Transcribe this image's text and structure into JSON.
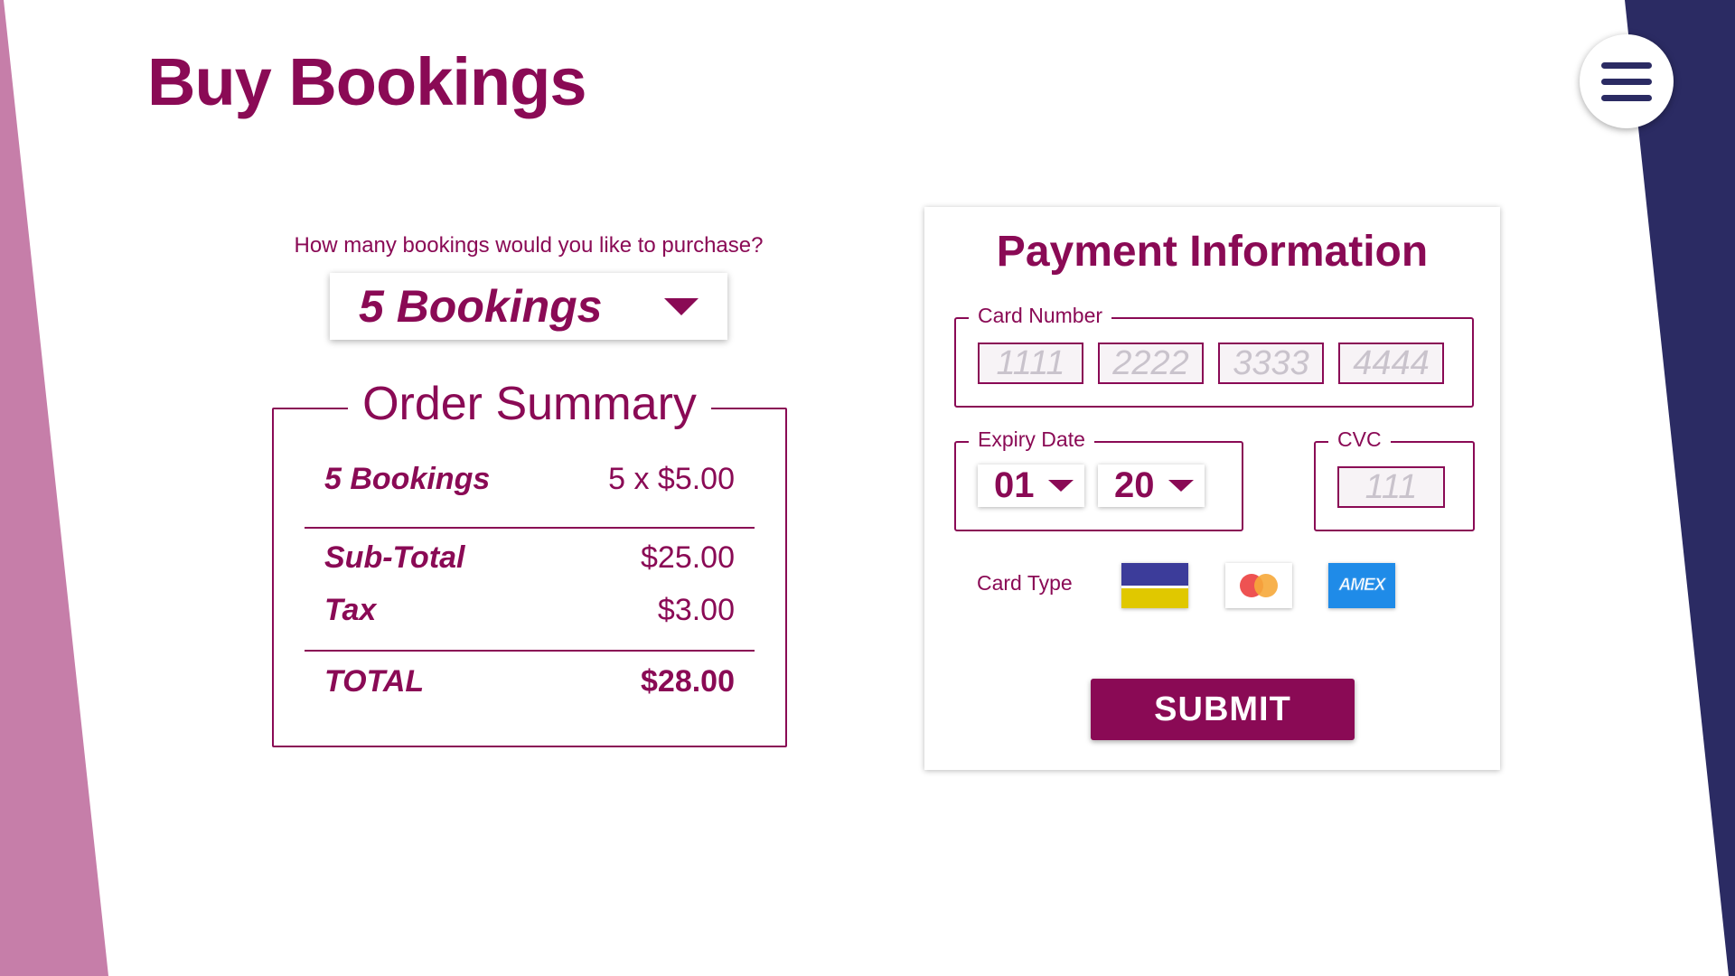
{
  "page": {
    "title": "Buy Bookings"
  },
  "menu": {
    "icon": "hamburger-menu-icon"
  },
  "quantity": {
    "question": "How many bookings would you like to purchase?",
    "selected": "5 Bookings"
  },
  "order_summary": {
    "title": "Order Summary",
    "line_item": {
      "label": "5 Bookings",
      "amount": "5 x $5.00"
    },
    "subtotal": {
      "label": "Sub-Total",
      "amount": "$25.00"
    },
    "tax": {
      "label": "Tax",
      "amount": "$3.00"
    },
    "total": {
      "label": "TOTAL",
      "amount": "$28.00"
    }
  },
  "payment": {
    "title": "Payment Information",
    "card_number": {
      "label": "Card Number",
      "placeholders": [
        "1111",
        "2222",
        "3333",
        "4444"
      ]
    },
    "expiry": {
      "label": "Expiry Date",
      "month": "01",
      "year": "20"
    },
    "cvc": {
      "label": "CVC",
      "placeholder": "111"
    },
    "card_type": {
      "label": "Card Type",
      "options": [
        "visa-card-icon",
        "mastercard-icon",
        "amex-card-icon"
      ],
      "amex_text": "AMEX"
    },
    "submit_label": "SUBMIT"
  },
  "colors": {
    "primary": "#8a0a55",
    "navy": "#2b2b63",
    "pink_band": "#c67ea9"
  }
}
